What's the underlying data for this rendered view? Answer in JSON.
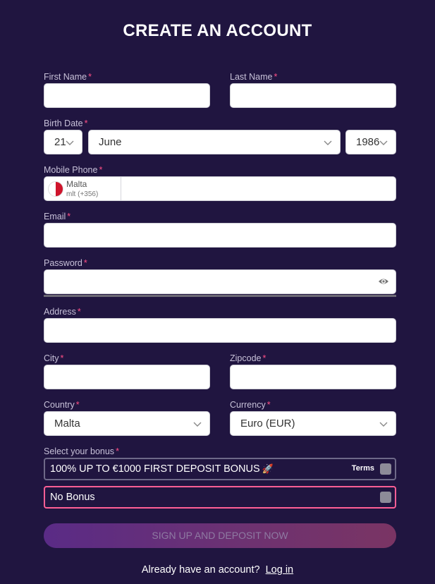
{
  "title": "CREATE AN ACCOUNT",
  "required_mark": "*",
  "first_name": {
    "label": "First Name",
    "value": ""
  },
  "last_name": {
    "label": "Last Name",
    "value": ""
  },
  "birth_date": {
    "label": "Birth Date",
    "day": "21",
    "month": "June",
    "year": "1986"
  },
  "mobile_phone": {
    "label": "Mobile Phone",
    "country": "Malta",
    "code": "mlt (+356)",
    "value": ""
  },
  "email": {
    "label": "Email",
    "value": ""
  },
  "password": {
    "label": "Password",
    "value": ""
  },
  "address": {
    "label": "Address",
    "value": ""
  },
  "city": {
    "label": "City",
    "value": ""
  },
  "zipcode": {
    "label": "Zipcode",
    "value": ""
  },
  "country": {
    "label": "Country",
    "value": "Malta"
  },
  "currency": {
    "label": "Currency",
    "value": "Euro (EUR)"
  },
  "bonus": {
    "label": "Select your bonus",
    "options": [
      {
        "label": "100% UP TO €1000 FIRST DEPOSIT BONUS",
        "terms": "Terms"
      },
      {
        "label": "No Bonus"
      }
    ]
  },
  "submit_label": "SIGN UP AND DEPOSIT NOW",
  "footer": {
    "text": "Already have an account?",
    "link": "Log in"
  },
  "colors": {
    "background": "#201540",
    "required": "#ff4f86",
    "selected_border": "#ff5f95",
    "button_gradient_start": "#5a2b86",
    "button_gradient_end": "#7a3464"
  }
}
